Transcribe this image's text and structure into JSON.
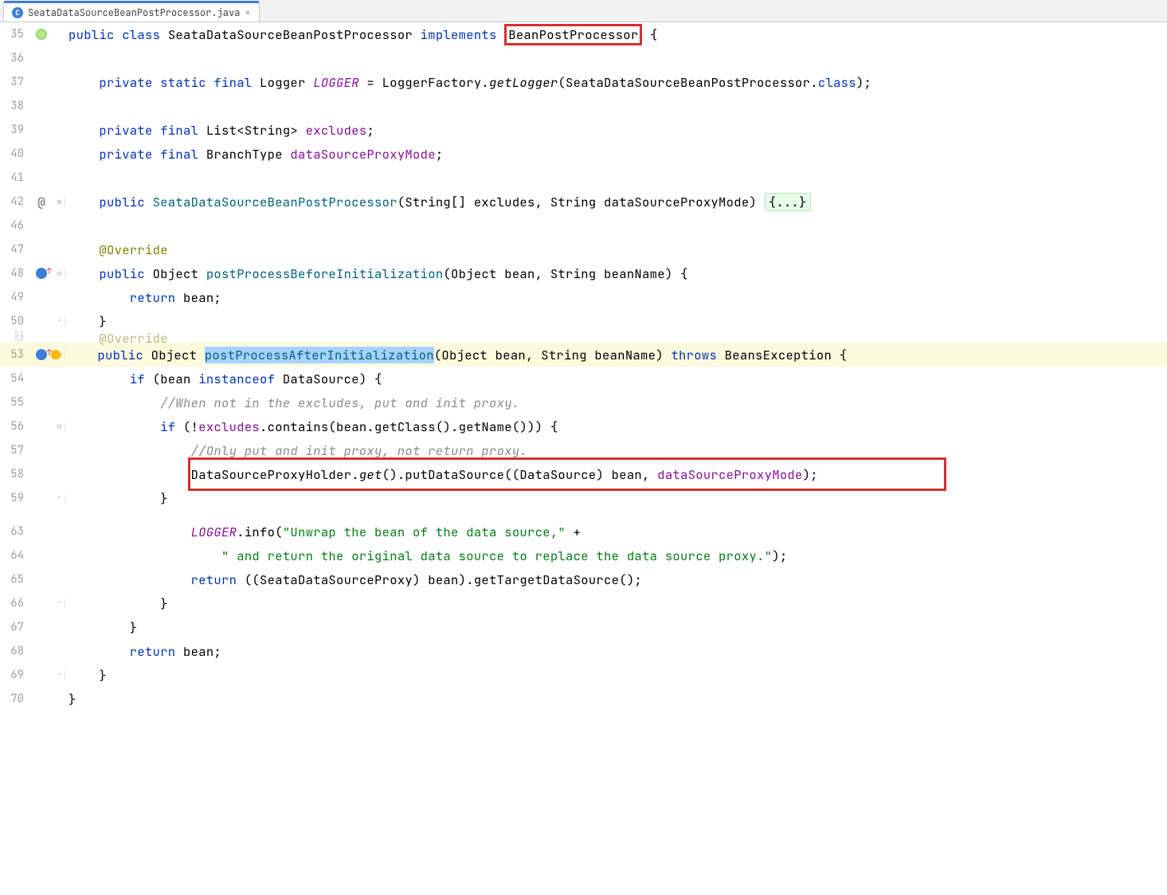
{
  "tab": {
    "filename": "SeataDataSourceBeanPostProcessor.java",
    "icon_letter": "C",
    "close_glyph": "×"
  },
  "annotations": {
    "redbox_1_text": "BeanPostProcessor",
    "redbox_2_start_line": 58,
    "selection_text": "postProcessAfterInitialization"
  },
  "lines": [
    {
      "n": "35",
      "icon": "class",
      "fold": "",
      "tokens": [
        {
          "t": "public ",
          "c": "kw"
        },
        {
          "t": "class ",
          "c": "kw"
        },
        {
          "t": "SeataDataSourceBeanPostProcessor ",
          "c": "type"
        },
        {
          "t": "implements ",
          "c": "kw"
        },
        {
          "t": "BeanPostProcessor",
          "c": "type",
          "red": true
        },
        {
          "t": " {",
          "c": "punct"
        }
      ]
    },
    {
      "n": "36",
      "tokens": []
    },
    {
      "n": "37",
      "tokens": [
        {
          "t": "    private static final ",
          "c": "kw"
        },
        {
          "t": "Logger ",
          "c": "type"
        },
        {
          "t": "LOGGER",
          "c": "static-field"
        },
        {
          "t": " = LoggerFactory.",
          "c": "punct"
        },
        {
          "t": "getLogger",
          "c": "static-call"
        },
        {
          "t": "(SeataDataSourceBeanPostProcessor.",
          "c": "punct"
        },
        {
          "t": "class",
          "c": "kw"
        },
        {
          "t": ");",
          "c": "punct"
        }
      ]
    },
    {
      "n": "38",
      "tokens": []
    },
    {
      "n": "39",
      "tokens": [
        {
          "t": "    private final ",
          "c": "kw"
        },
        {
          "t": "List<String> ",
          "c": "type"
        },
        {
          "t": "excludes",
          "c": "field"
        },
        {
          "t": ";",
          "c": "punct"
        }
      ]
    },
    {
      "n": "40",
      "tokens": [
        {
          "t": "    private final ",
          "c": "kw"
        },
        {
          "t": "BranchType ",
          "c": "type"
        },
        {
          "t": "dataSourceProxyMode",
          "c": "field"
        },
        {
          "t": ";",
          "c": "punct"
        }
      ]
    },
    {
      "n": "41",
      "tokens": []
    },
    {
      "n": "42",
      "icon": "at",
      "fold": "+",
      "tokens": [
        {
          "t": "    public ",
          "c": "kw"
        },
        {
          "t": "SeataDataSourceBeanPostProcessor",
          "c": "method-decl"
        },
        {
          "t": "(String[] excludes, String dataSourceProxyMode) ",
          "c": "punct"
        },
        {
          "t": "{...}",
          "c": "fold-block"
        }
      ]
    },
    {
      "n": "46",
      "tokens": []
    },
    {
      "n": "47",
      "tokens": [
        {
          "t": "    @Override",
          "c": "anno"
        }
      ]
    },
    {
      "n": "48",
      "icon": "override",
      "fold": "-",
      "tokens": [
        {
          "t": "    public ",
          "c": "kw"
        },
        {
          "t": "Object ",
          "c": "type"
        },
        {
          "t": "postProcessBeforeInitialization",
          "c": "method-decl"
        },
        {
          "t": "(Object bean, String beanName) {",
          "c": "punct"
        }
      ]
    },
    {
      "n": "49",
      "tokens": [
        {
          "t": "        return ",
          "c": "kw"
        },
        {
          "t": "bean;",
          "c": "punct"
        }
      ]
    },
    {
      "n": "50",
      "fold": "^",
      "tokens": [
        {
          "t": "    }",
          "c": "punct"
        }
      ]
    },
    {
      "n": "51/52",
      "folded": true,
      "tokens": [
        {
          "t": "    @Override",
          "c": "anno"
        }
      ]
    },
    {
      "n": "53",
      "icon": "override",
      "fold": "-",
      "current": true,
      "bulb": true,
      "tokens": [
        {
          "t": "    public ",
          "c": "kw"
        },
        {
          "t": "Object ",
          "c": "type"
        },
        {
          "t": "postProcessAfterInitialization",
          "c": "method-decl",
          "sel": true
        },
        {
          "t": "(Object bean, String beanName) ",
          "c": "punct"
        },
        {
          "t": "throws ",
          "c": "kw"
        },
        {
          "t": "BeansException {",
          "c": "punct"
        }
      ]
    },
    {
      "n": "54",
      "tokens": [
        {
          "t": "        if ",
          "c": "kw"
        },
        {
          "t": "(bean ",
          "c": "punct"
        },
        {
          "t": "instanceof ",
          "c": "kw"
        },
        {
          "t": "DataSource) {",
          "c": "punct"
        }
      ]
    },
    {
      "n": "55",
      "tokens": [
        {
          "t": "            //When not in the excludes, put and init proxy.",
          "c": "cmt"
        }
      ]
    },
    {
      "n": "56",
      "fold": "-",
      "tokens": [
        {
          "t": "            if ",
          "c": "kw"
        },
        {
          "t": "(!",
          "c": "punct"
        },
        {
          "t": "excludes",
          "c": "field"
        },
        {
          "t": ".contains(bean.getClass().getName())) {",
          "c": "punct"
        }
      ]
    },
    {
      "n": "57",
      "tokens": [
        {
          "t": "                //Only put and init proxy, not return proxy.",
          "c": "cmt"
        }
      ]
    },
    {
      "n": "58",
      "tokens": [
        {
          "t": "                DataSourceProxyHolder.",
          "c": "punct"
        },
        {
          "t": "get",
          "c": "static-call"
        },
        {
          "t": "().putDataSource((DataSource) bean, ",
          "c": "punct"
        },
        {
          "t": "dataSourceProxyMode",
          "c": "field"
        },
        {
          "t": ");",
          "c": "punct"
        }
      ]
    },
    {
      "n": "59",
      "fold": "^",
      "tokens": [
        {
          "t": "            }",
          "c": "punct"
        }
      ]
    },
    {
      "n": "",
      "folded": true,
      "tokens": [
        {
          "t": "",
          "c": ""
        }
      ]
    },
    {
      "n": "63",
      "tokens": [
        {
          "t": "                ",
          "c": ""
        },
        {
          "t": "LOGGER",
          "c": "static-field"
        },
        {
          "t": ".info(",
          "c": "punct"
        },
        {
          "t": "\"Unwrap the bean of the data source,\"",
          "c": "str"
        },
        {
          "t": " +",
          "c": "punct"
        }
      ]
    },
    {
      "n": "64",
      "tokens": [
        {
          "t": "                    ",
          "c": ""
        },
        {
          "t": "\" and return the original data source to replace the data source proxy.\"",
          "c": "str"
        },
        {
          "t": ");",
          "c": "punct"
        }
      ]
    },
    {
      "n": "65",
      "tokens": [
        {
          "t": "                return ",
          "c": "kw"
        },
        {
          "t": "((SeataDataSourceProxy) bean).getTargetDataSource();",
          "c": "punct"
        }
      ]
    },
    {
      "n": "66",
      "fold": "^",
      "tokens": [
        {
          "t": "            }",
          "c": "punct"
        }
      ]
    },
    {
      "n": "67",
      "tokens": [
        {
          "t": "        }",
          "c": "punct"
        }
      ]
    },
    {
      "n": "68",
      "tokens": [
        {
          "t": "        return ",
          "c": "kw"
        },
        {
          "t": "bean;",
          "c": "punct"
        }
      ]
    },
    {
      "n": "69",
      "fold": "^",
      "tokens": [
        {
          "t": "    }",
          "c": "punct"
        }
      ]
    },
    {
      "n": "70",
      "tokens": [
        {
          "t": "}",
          "c": "punct"
        }
      ]
    }
  ]
}
